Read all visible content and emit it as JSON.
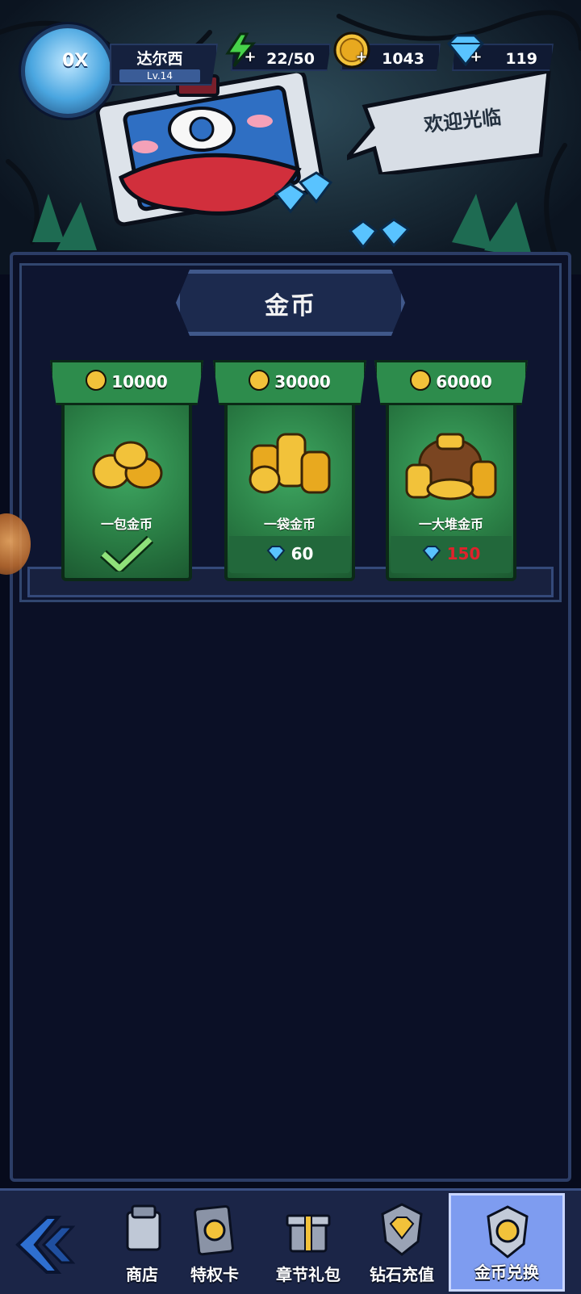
{
  "player": {
    "name": "达尔西",
    "level": "Lv.14",
    "avatar_mark": "0X"
  },
  "resources": {
    "energy": "22/50",
    "gold": "1043",
    "gems": "119"
  },
  "merchant": {
    "speech": "欢迎光临"
  },
  "shop": {
    "title": "金币",
    "items": [
      {
        "amount": "10000",
        "name": "一包金币",
        "status": "purchased"
      },
      {
        "amount": "30000",
        "name": "一袋金币",
        "cost": "60"
      },
      {
        "amount": "60000",
        "name": "一大堆金币",
        "cost": "150"
      }
    ]
  },
  "nav": {
    "tabs": [
      {
        "label": "商店"
      },
      {
        "label": "特权卡"
      },
      {
        "label": "章节礼包"
      },
      {
        "label": "钻石充值"
      },
      {
        "label": "金币兑换",
        "active": true
      }
    ]
  },
  "colors": {
    "card_green": "#2d8c4c",
    "cost_red": "#e0222c",
    "active_tab": "#7e9cf0",
    "frame": "#2c3d66"
  }
}
